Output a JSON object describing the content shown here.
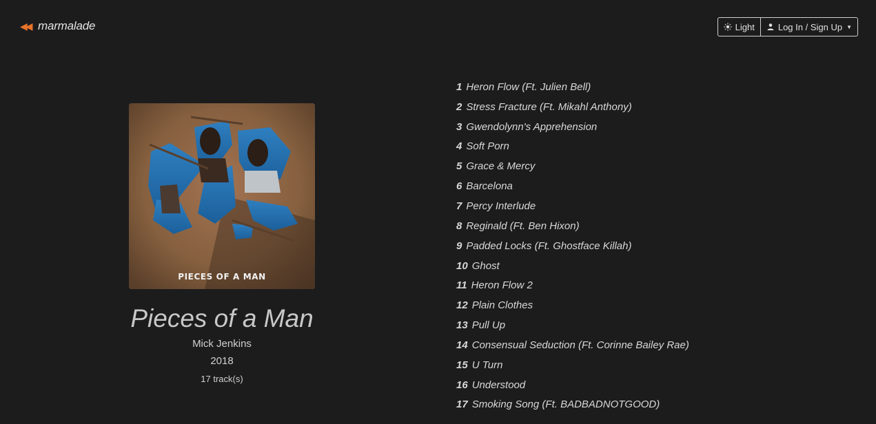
{
  "header": {
    "logo_text": "marmalade",
    "theme_label": "Light",
    "account_label": "Log In / Sign Up"
  },
  "album": {
    "cover_text": "PIECES OF A MAN",
    "title": "Pieces of a Man",
    "artist": "Mick Jenkins",
    "year": "2018",
    "track_count": "17 track(s)"
  },
  "tracks": [
    {
      "num": "1",
      "title": "Heron Flow (Ft. Julien Bell)"
    },
    {
      "num": "2",
      "title": "Stress Fracture (Ft. Mikahl Anthony)"
    },
    {
      "num": "3",
      "title": "Gwendolynn's Apprehension"
    },
    {
      "num": "4",
      "title": "Soft Porn"
    },
    {
      "num": "5",
      "title": "Grace & Mercy"
    },
    {
      "num": "6",
      "title": "Barcelona"
    },
    {
      "num": "7",
      "title": "Percy Interlude"
    },
    {
      "num": "8",
      "title": "Reginald (Ft. Ben Hixon)"
    },
    {
      "num": "9",
      "title": "Padded Locks (Ft. Ghostface Killah)"
    },
    {
      "num": "10",
      "title": "Ghost"
    },
    {
      "num": "11",
      "title": "Heron Flow 2"
    },
    {
      "num": "12",
      "title": "Plain Clothes"
    },
    {
      "num": "13",
      "title": "Pull Up"
    },
    {
      "num": "14",
      "title": "Consensual Seduction (Ft. Corinne Bailey Rae)"
    },
    {
      "num": "15",
      "title": "U Turn"
    },
    {
      "num": "16",
      "title": "Understood"
    },
    {
      "num": "17",
      "title": "Smoking Song (Ft. BADBADNOTGOOD)"
    }
  ],
  "colors": {
    "background": "#1c1c1d",
    "accent": "#e8742a",
    "text": "#d2d2d2"
  }
}
